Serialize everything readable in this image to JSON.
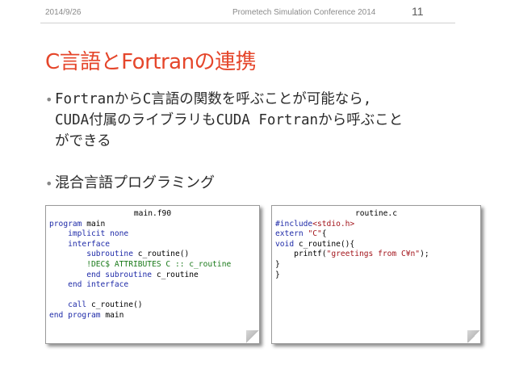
{
  "header": {
    "date": "2014/9/26",
    "conference": "Prometech Simulation Conference 2014",
    "page_number": "11"
  },
  "slide": {
    "title": "C言語とFortranの連携",
    "bullets": [
      "FortranからC言語の関数を呼ぶことが可能なら,\nCUDA付属のライブラリもCUDA Fortranから呼ぶこと\nができる",
      "混合言語プログラミング"
    ]
  },
  "code_left": {
    "filename": "main.f90",
    "lines": [
      [
        {
          "t": "program",
          "c": "kw"
        },
        {
          "t": " main",
          "c": ""
        }
      ],
      [
        {
          "t": "    implicit none",
          "c": "kw"
        }
      ],
      [
        {
          "t": "    interface",
          "c": "kw"
        }
      ],
      [
        {
          "t": "        subroutine",
          "c": "kw"
        },
        {
          "t": " c_routine()",
          "c": ""
        }
      ],
      [
        {
          "t": "        !DEC$ ATTRIBUTES C :: c_routine",
          "c": "cm"
        }
      ],
      [
        {
          "t": "        end subroutine",
          "c": "kw"
        },
        {
          "t": " c_routine",
          "c": ""
        }
      ],
      [
        {
          "t": "    end interface",
          "c": "kw"
        }
      ],
      [
        {
          "t": "",
          "c": ""
        }
      ],
      [
        {
          "t": "    call",
          "c": "kw"
        },
        {
          "t": " c_routine()",
          "c": ""
        }
      ],
      [
        {
          "t": "end program",
          "c": "kw"
        },
        {
          "t": " main",
          "c": ""
        }
      ]
    ]
  },
  "code_right": {
    "filename": "routine.c",
    "lines": [
      [
        {
          "t": "#include",
          "c": "kw"
        },
        {
          "t": "<stdio.h>",
          "c": "str"
        }
      ],
      [
        {
          "t": "extern",
          "c": "kw"
        },
        {
          "t": " ",
          "c": ""
        },
        {
          "t": "\"C\"",
          "c": "str"
        },
        {
          "t": "{",
          "c": ""
        }
      ],
      [
        {
          "t": "void",
          "c": "kw"
        },
        {
          "t": " c_routine(){",
          "c": ""
        }
      ],
      [
        {
          "t": "    printf(",
          "c": ""
        },
        {
          "t": "\"greetings from C¥n\"",
          "c": "str"
        },
        {
          "t": ");",
          "c": ""
        }
      ],
      [
        {
          "t": "}",
          "c": ""
        }
      ],
      [
        {
          "t": "}",
          "c": ""
        }
      ]
    ]
  }
}
